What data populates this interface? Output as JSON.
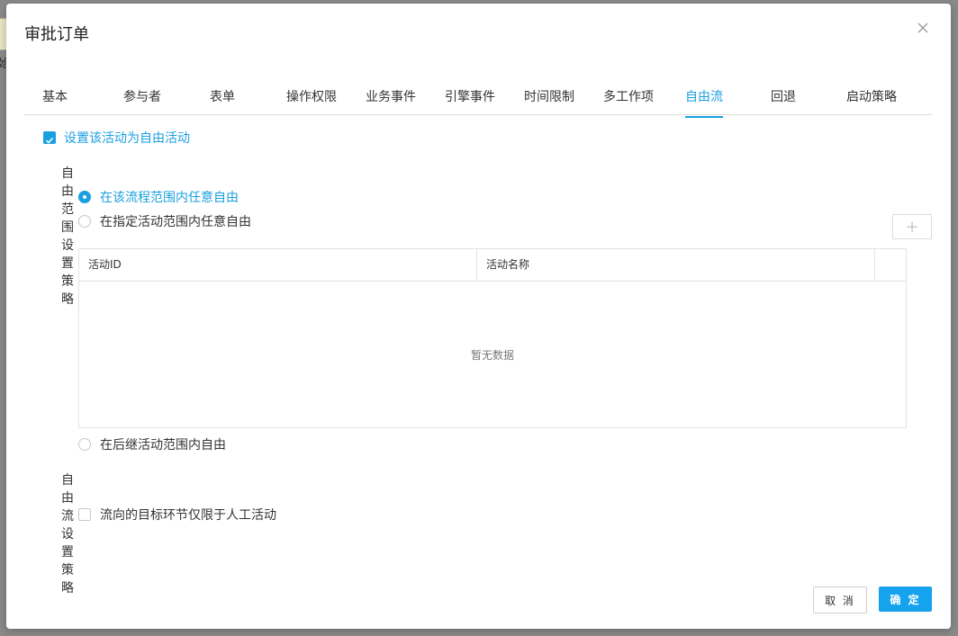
{
  "background": {
    "node_text": "始"
  },
  "dialog": {
    "title": "审批订单",
    "tabs": [
      {
        "label": "基本"
      },
      {
        "label": "参与者"
      },
      {
        "label": "表单"
      },
      {
        "label": "操作权限"
      },
      {
        "label": "业务事件"
      },
      {
        "label": "引擎事件"
      },
      {
        "label": "时间限制"
      },
      {
        "label": "多工作项"
      },
      {
        "label": "自由流"
      },
      {
        "label": "回退"
      },
      {
        "label": "启动策略"
      }
    ],
    "active_tab": "自由流",
    "free_activity_checkbox": {
      "label": "设置该活动为自由活动",
      "checked": true
    },
    "scope_policy": {
      "title": "自由范围设置策略",
      "options": [
        {
          "label": "在该流程范围内任意自由",
          "checked": true
        },
        {
          "label": "在指定活动范围内任意自由",
          "checked": false
        },
        {
          "label": "在后继活动范围内自由",
          "checked": false
        }
      ],
      "add_button": "+",
      "table": {
        "columns": [
          "活动ID",
          "活动名称"
        ],
        "empty_text": "暂无数据"
      }
    },
    "flow_policy": {
      "title": "自由流设置策略",
      "manual_only_checkbox": {
        "label": "流向的目标环节仅限于人工活动",
        "checked": false
      }
    },
    "buttons": {
      "cancel": "取 消",
      "ok": "确 定"
    }
  },
  "colors": {
    "accent": "#1a9fe0",
    "primary_button": "#15a3ee",
    "overlay": "#8a8a8a"
  }
}
